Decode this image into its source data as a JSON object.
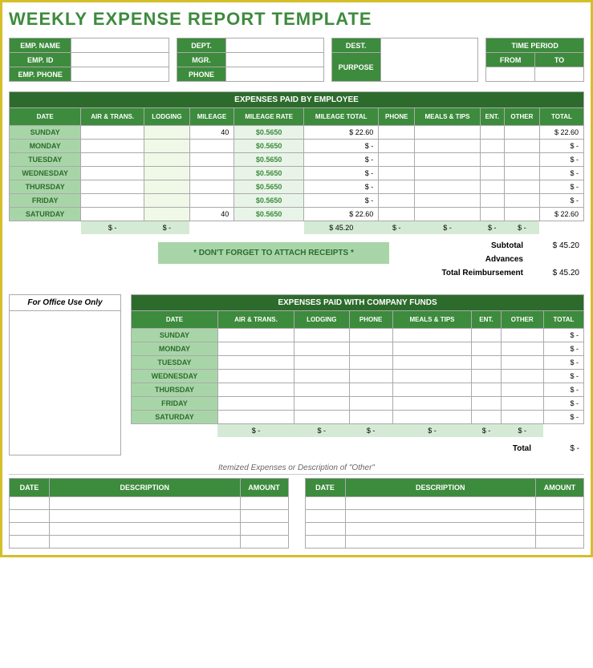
{
  "title": "WEEKLY EXPENSE REPORT TEMPLATE",
  "info": {
    "emp_name": "EMP. NAME",
    "emp_id": "EMP. ID",
    "emp_phone": "EMP. PHONE",
    "dept": "DEPT.",
    "mgr": "MGR.",
    "phone": "PHONE",
    "dest": "DEST.",
    "purpose": "PURPOSE",
    "time_period": "TIME PERIOD",
    "from": "FROM",
    "to": "TO"
  },
  "emp_expenses": {
    "title": "EXPENSES PAID BY EMPLOYEE",
    "headers": [
      "DATE",
      "AIR & TRANS.",
      "LODGING",
      "MILEAGE",
      "MILEAGE RATE",
      "MILEAGE TOTAL",
      "PHONE",
      "MEALS & TIPS",
      "ENT.",
      "OTHER",
      "TOTAL"
    ],
    "rows": [
      {
        "day": "SUNDAY",
        "mileage": "40",
        "rate": "$0.5650",
        "mtotal": "$    22.60",
        "total": "$    22.60"
      },
      {
        "day": "MONDAY",
        "mileage": "",
        "rate": "$0.5650",
        "mtotal": "$        -",
        "total": "$        -"
      },
      {
        "day": "TUESDAY",
        "mileage": "",
        "rate": "$0.5650",
        "mtotal": "$        -",
        "total": "$        -"
      },
      {
        "day": "WEDNESDAY",
        "mileage": "",
        "rate": "$0.5650",
        "mtotal": "$        -",
        "total": "$        -"
      },
      {
        "day": "THURSDAY",
        "mileage": "",
        "rate": "$0.5650",
        "mtotal": "$        -",
        "total": "$        -"
      },
      {
        "day": "FRIDAY",
        "mileage": "",
        "rate": "$0.5650",
        "mtotal": "$        -",
        "total": "$        -"
      },
      {
        "day": "SATURDAY",
        "mileage": "40",
        "rate": "$0.5650",
        "mtotal": "$    22.60",
        "total": "$    22.60"
      }
    ],
    "sums": {
      "air": "$      -",
      "lodging": "$      -",
      "mtotal": "$    45.20",
      "phone": "$      -",
      "meals": "$      -",
      "ent": "$      -",
      "other": "$      -"
    },
    "receipt_note": "* DON'T FORGET TO ATTACH RECEIPTS *",
    "subtotal_label": "Subtotal",
    "subtotal": "$    45.20",
    "advances_label": "Advances",
    "advances": "",
    "reimb_label": "Total Reimbursement",
    "reimb": "$    45.20"
  },
  "office": {
    "label": "For Office Use Only"
  },
  "cf_expenses": {
    "title": "EXPENSES PAID WITH COMPANY FUNDS",
    "headers": [
      "DATE",
      "AIR & TRANS.",
      "LODGING",
      "PHONE",
      "MEALS & TIPS",
      "ENT.",
      "OTHER",
      "TOTAL"
    ],
    "rows": [
      {
        "day": "SUNDAY",
        "total": "$      -"
      },
      {
        "day": "MONDAY",
        "total": "$      -"
      },
      {
        "day": "TUESDAY",
        "total": "$      -"
      },
      {
        "day": "WEDNESDAY",
        "total": "$      -"
      },
      {
        "day": "THURSDAY",
        "total": "$      -"
      },
      {
        "day": "FRIDAY",
        "total": "$      -"
      },
      {
        "day": "SATURDAY",
        "total": "$      -"
      }
    ],
    "sums": {
      "v": "$      -"
    },
    "total_label": "Total",
    "total": "$      -"
  },
  "itemized": {
    "title": "Itemized Expenses or Description of \"Other\"",
    "headers": [
      "DATE",
      "DESCRIPTION",
      "AMOUNT"
    ]
  }
}
